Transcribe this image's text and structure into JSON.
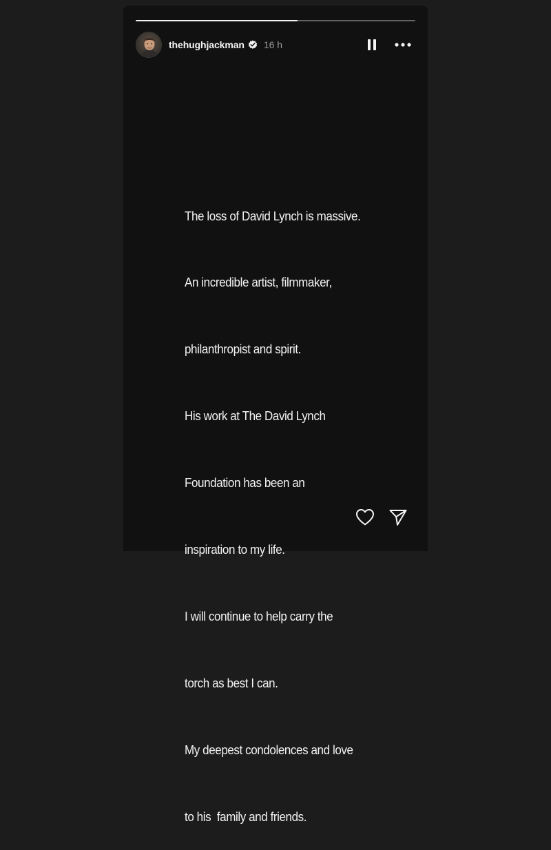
{
  "story": {
    "progress_fraction": 0.58,
    "author": {
      "username": "thehughjackman",
      "verified": true,
      "time_ago": "16 h",
      "avatar": "profile-photo"
    },
    "controls": {
      "pause_icon": "pause-icon",
      "more_icon": "more-options-icon"
    },
    "text_lines": [
      "The loss of David Lynch is massive.",
      "An incredible artist, filmmaker,",
      "philanthropist and spirit.",
      "His work at The David Lynch",
      "Foundation has been an",
      "inspiration to my life.",
      "I will continue to help carry the",
      "torch as best I can.",
      "My deepest condolences and love",
      "to his  family and friends."
    ],
    "footer": {
      "like_icon": "heart-icon",
      "share_icon": "send-icon"
    }
  }
}
